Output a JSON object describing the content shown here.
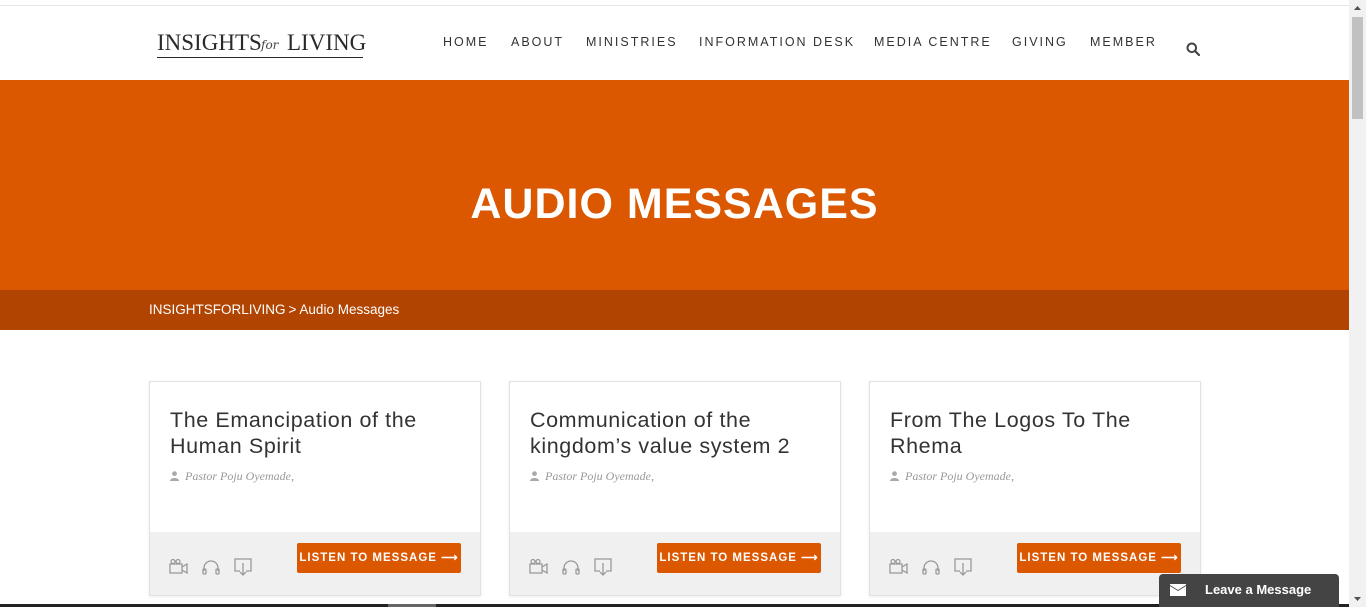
{
  "logo": {
    "left": "INSIGHTS",
    "for": "for",
    "right": "LIVING"
  },
  "nav": {
    "items": [
      "HOME",
      "ABOUT",
      "MINISTRIES",
      "INFORMATION DESK",
      "MEDIA CENTRE",
      "GIVING",
      "MEMBER"
    ],
    "search_icon": "search-icon"
  },
  "hero": {
    "title": "AUDIO MESSAGES"
  },
  "breadcrumb": {
    "root": "INSIGHTSFORLIVING",
    "separator": ">",
    "current": "Audio Messages"
  },
  "cards": [
    {
      "title": "The Emancipation of the Human Spirit",
      "author": "Pastor Poju Oyemade,",
      "button": "LISTEN TO MESSAGE ⟶"
    },
    {
      "title": "Communication of the kingdom’s value system 2",
      "author": "Pastor Poju Oyemade,",
      "button": "LISTEN TO MESSAGE ⟶"
    },
    {
      "title": "From The Logos To The Rhema",
      "author": "Pastor Poju Oyemade,",
      "button": "LISTEN TO MESSAGE ⟶"
    }
  ],
  "chat": {
    "label": "Leave a Message",
    "icon": "envelope-icon"
  },
  "colors": {
    "accent": "#db5700",
    "breadcrumb_bg": "#b04400",
    "chat_bg": "#444444"
  }
}
